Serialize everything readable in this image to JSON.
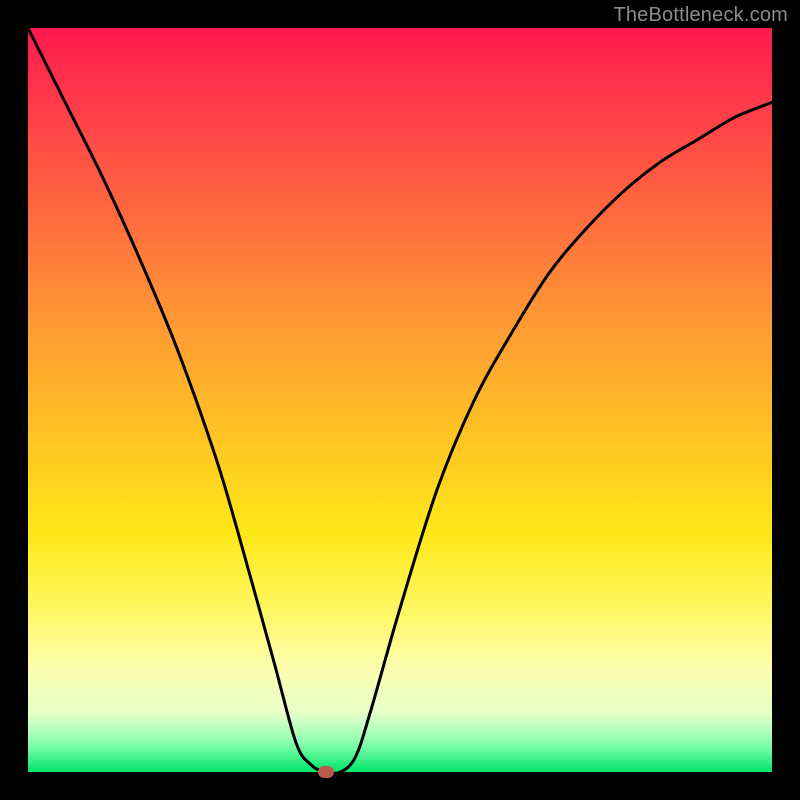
{
  "watermark": {
    "text": "TheBottleneck.com"
  },
  "chart_data": {
    "type": "line",
    "title": "",
    "xlabel": "",
    "ylabel": "",
    "xlim": [
      0,
      100
    ],
    "ylim": [
      0,
      100
    ],
    "grid": false,
    "legend": false,
    "background": {
      "gradient": "vertical",
      "stops": [
        {
          "pos": 0.0,
          "color": "#ff1a4d"
        },
        {
          "pos": 0.55,
          "color": "#ffc423"
        },
        {
          "pos": 0.78,
          "color": "#fff760"
        },
        {
          "pos": 1.0,
          "color": "#00e66a"
        }
      ]
    },
    "series": [
      {
        "name": "bottleneck-curve",
        "color": "#000000",
        "x": [
          0,
          5,
          10,
          15,
          20,
          25,
          28,
          33,
          36,
          38,
          40,
          42,
          44,
          46,
          50,
          55,
          60,
          65,
          70,
          75,
          80,
          85,
          90,
          95,
          100
        ],
        "y": [
          100,
          90,
          80,
          69,
          57,
          43,
          33,
          15,
          4,
          1,
          0,
          0,
          2,
          8,
          22,
          38,
          50,
          59,
          67,
          73,
          78,
          82,
          85,
          88,
          90
        ]
      }
    ],
    "marker": {
      "x": 40,
      "y": 0,
      "color": "#b85a4a"
    }
  }
}
